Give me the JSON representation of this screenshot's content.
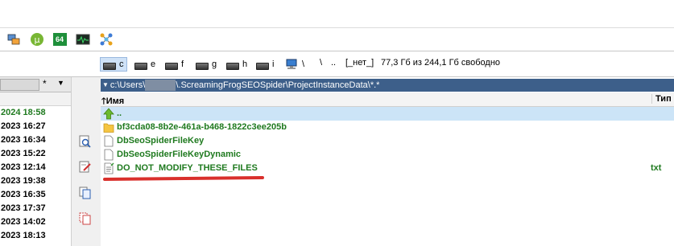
{
  "toolbar": {
    "buttons": [
      {
        "name": "network-icon"
      },
      {
        "name": "utorrent-icon",
        "glyph": "µ"
      },
      {
        "name": "sixty-four-icon",
        "label": "64"
      },
      {
        "name": "activity-monitor-icon"
      },
      {
        "name": "molecule-icon"
      }
    ]
  },
  "drives": [
    {
      "letter": "c",
      "selected": true
    },
    {
      "letter": "e"
    },
    {
      "letter": "f"
    },
    {
      "letter": "g"
    },
    {
      "letter": "h"
    },
    {
      "letter": "i"
    }
  ],
  "drive_nav": {
    "root": "\\",
    "up": "..",
    "label": "[_нет_]",
    "space": "77,3 Гб из 244,1 Гб свободно"
  },
  "left_panel": {
    "filter_star": "*",
    "filter_arrow": "▼",
    "dates": [
      {
        "text": "2024 18:58",
        "green": true
      },
      {
        "text": "2023 16:27"
      },
      {
        "text": "2023 16:34"
      },
      {
        "text": "2023 15:22"
      },
      {
        "text": "2023 12:14"
      },
      {
        "text": "2023 19:38"
      },
      {
        "text": "2023 16:35"
      },
      {
        "text": "2023 17:37"
      },
      {
        "text": "2023 14:02"
      },
      {
        "text": "2023 18:13"
      }
    ]
  },
  "right_panel": {
    "path_prefix": "c:\\Users\\",
    "path_suffix": "\\.ScreamingFrogSEOSpider\\ProjectInstanceData\\*.*",
    "col_name": "Имя",
    "col_type": "Тип",
    "rows": [
      {
        "name": "..",
        "icon": "up-arrow",
        "ext": "",
        "selected": true
      },
      {
        "name": "bf3cda08-8b2e-461a-b468-1822c3ee205b",
        "icon": "folder",
        "ext": ""
      },
      {
        "name": "DbSeoSpiderFileKey",
        "icon": "file",
        "ext": ""
      },
      {
        "name": "DbSeoSpiderFileKeyDynamic",
        "icon": "file",
        "ext": ""
      },
      {
        "name": "DO_NOT_MODIFY_THESE_FILES",
        "icon": "text-file",
        "ext": "txt"
      }
    ]
  },
  "colors": {
    "green_text": "#1f7a1f",
    "path_bar": "#3d5f8a",
    "selection": "#cce4f7",
    "annotation": "#d9302c"
  }
}
